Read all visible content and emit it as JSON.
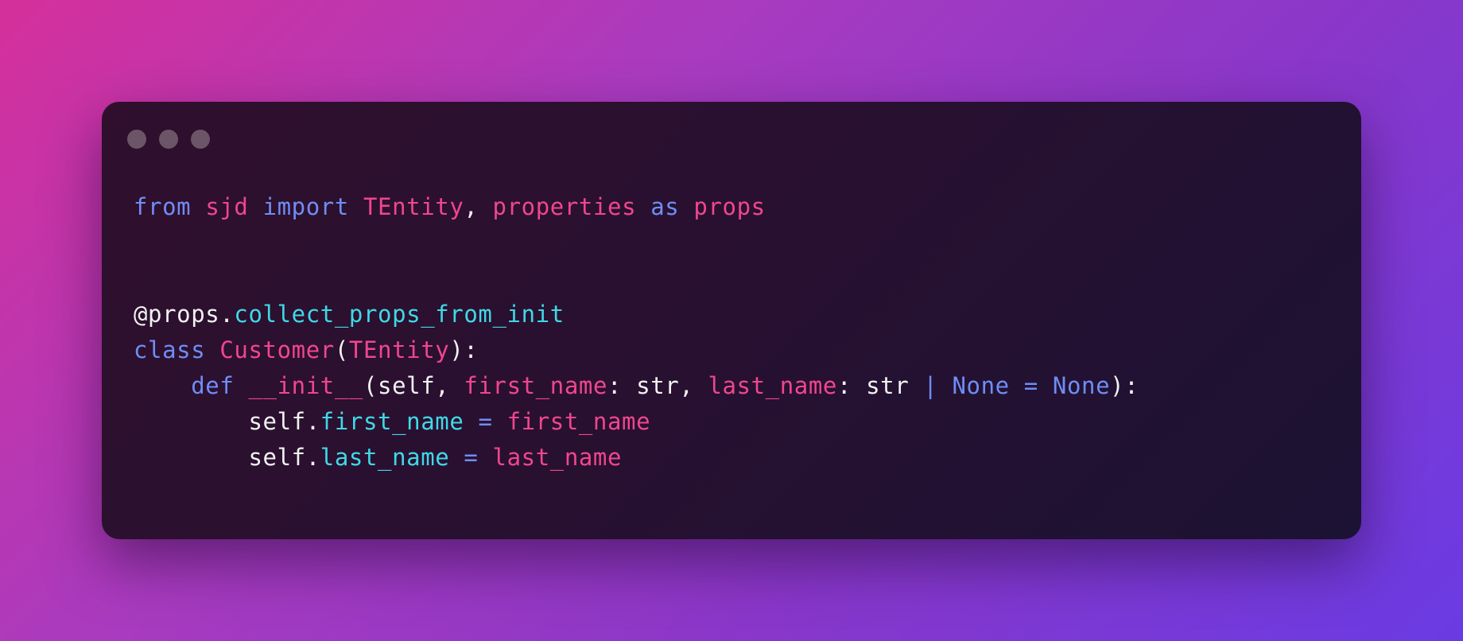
{
  "window": {
    "buttons": [
      "close",
      "minimize",
      "maximize"
    ]
  },
  "code": {
    "language": "python",
    "lines": [
      [
        {
          "t": "from",
          "c": "kw"
        },
        {
          "t": " ",
          "c": "pl"
        },
        {
          "t": "sjd",
          "c": "nm"
        },
        {
          "t": " ",
          "c": "pl"
        },
        {
          "t": "import",
          "c": "kw"
        },
        {
          "t": " ",
          "c": "pl"
        },
        {
          "t": "TEntity",
          "c": "nm"
        },
        {
          "t": ", ",
          "c": "pl"
        },
        {
          "t": "properties",
          "c": "nm"
        },
        {
          "t": " ",
          "c": "pl"
        },
        {
          "t": "as",
          "c": "kw"
        },
        {
          "t": " ",
          "c": "pl"
        },
        {
          "t": "props",
          "c": "nm"
        }
      ],
      [],
      [],
      [
        {
          "t": "@props.",
          "c": "pl"
        },
        {
          "t": "collect_props_from_init",
          "c": "at"
        }
      ],
      [
        {
          "t": "class",
          "c": "kw"
        },
        {
          "t": " ",
          "c": "pl"
        },
        {
          "t": "Customer",
          "c": "nm"
        },
        {
          "t": "(",
          "c": "pl"
        },
        {
          "t": "TEntity",
          "c": "nm"
        },
        {
          "t": "):",
          "c": "pl"
        }
      ],
      [
        {
          "t": "    ",
          "c": "pl"
        },
        {
          "t": "def",
          "c": "kw"
        },
        {
          "t": " ",
          "c": "pl"
        },
        {
          "t": "__init__",
          "c": "nm"
        },
        {
          "t": "(self, ",
          "c": "pl"
        },
        {
          "t": "first_name",
          "c": "nm"
        },
        {
          "t": ": str, ",
          "c": "pl"
        },
        {
          "t": "last_name",
          "c": "nm"
        },
        {
          "t": ": str ",
          "c": "pl"
        },
        {
          "t": "|",
          "c": "kw"
        },
        {
          "t": " ",
          "c": "pl"
        },
        {
          "t": "None",
          "c": "kw"
        },
        {
          "t": " ",
          "c": "pl"
        },
        {
          "t": "=",
          "c": "kw"
        },
        {
          "t": " ",
          "c": "pl"
        },
        {
          "t": "None",
          "c": "kw"
        },
        {
          "t": "):",
          "c": "pl"
        }
      ],
      [
        {
          "t": "        self.",
          "c": "pl"
        },
        {
          "t": "first_name",
          "c": "at"
        },
        {
          "t": " ",
          "c": "pl"
        },
        {
          "t": "=",
          "c": "kw"
        },
        {
          "t": " ",
          "c": "pl"
        },
        {
          "t": "first_name",
          "c": "nm"
        }
      ],
      [
        {
          "t": "        self.",
          "c": "pl"
        },
        {
          "t": "last_name",
          "c": "at"
        },
        {
          "t": " ",
          "c": "pl"
        },
        {
          "t": "=",
          "c": "kw"
        },
        {
          "t": " ",
          "c": "pl"
        },
        {
          "t": "last_name",
          "c": "nm"
        }
      ]
    ]
  },
  "colors": {
    "keyword": "#6f8df5",
    "name": "#f0468e",
    "attribute": "#3fd9e6",
    "plain": "#f2f2f2",
    "window_dot": "#6b5566"
  }
}
